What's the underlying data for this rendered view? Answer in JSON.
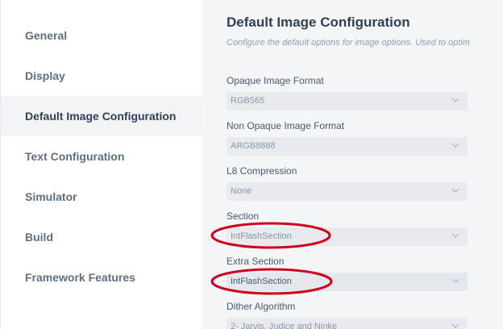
{
  "sidebar": {
    "items": [
      {
        "label": "General",
        "active": false
      },
      {
        "label": "Display",
        "active": false
      },
      {
        "label": "Default Image Configuration",
        "active": true
      },
      {
        "label": "Text Configuration",
        "active": false
      },
      {
        "label": "Simulator",
        "active": false
      },
      {
        "label": "Build",
        "active": false
      },
      {
        "label": "Framework Features",
        "active": false
      }
    ]
  },
  "main": {
    "title": "Default Image Configuration",
    "subtitle": "Configure the default options for image options. Used to optim",
    "fields": [
      {
        "label": "Opaque Image Format",
        "value": "RGB565"
      },
      {
        "label": "Non Opaque Image Format",
        "value": "ARGB8888"
      },
      {
        "label": "L8 Compression",
        "value": "None"
      },
      {
        "label": "Section",
        "value": "IntFlashSection"
      },
      {
        "label": "Extra Section",
        "value": "IntFlashSection"
      },
      {
        "label": "Dither Algorithm",
        "value": "2- Jarvis, Judice and Ninke"
      }
    ]
  },
  "colors": {
    "annotation": "#d0021b",
    "active_bg": "#f3f4f6",
    "select_bg": "#e8eaee"
  }
}
